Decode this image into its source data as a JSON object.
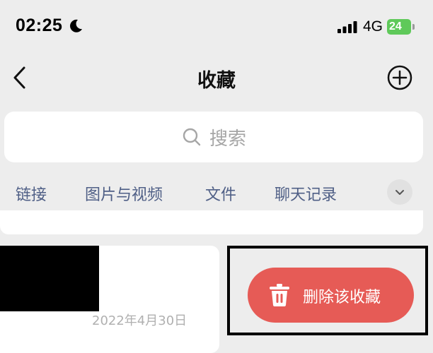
{
  "status_bar": {
    "time": "02:25",
    "network": "4G",
    "battery": "24"
  },
  "nav": {
    "title": "收藏"
  },
  "search": {
    "placeholder": "搜索"
  },
  "tabs": [
    {
      "label": "链接"
    },
    {
      "label": "图片与视频"
    },
    {
      "label": "文件"
    },
    {
      "label": "聊天记录"
    }
  ],
  "item": {
    "date": "2022年4月30日"
  },
  "swipe_action": {
    "label": "删除该收藏"
  },
  "colors": {
    "background": "#ededed",
    "tab_text": "#4f5f86",
    "delete": "#e65b56",
    "battery": "#5fc95a"
  }
}
